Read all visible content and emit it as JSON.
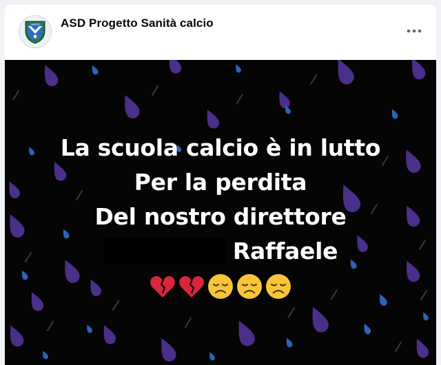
{
  "post": {
    "page_name": "ASD Progetto Sanità calcio",
    "avatar_text": "SANITÀ",
    "more_icon": "more-horizontal-icon",
    "image": {
      "lines": [
        "La scuola calcio è in lutto",
        "Per la perdita",
        "Del nostro direttore",
        "Raffaele"
      ],
      "emojis": [
        "broken-heart-icon",
        "broken-heart-icon",
        "disappointed-face-icon",
        "disappointed-face-icon",
        "disappointed-face-icon"
      ],
      "redacted": true
    }
  },
  "colors": {
    "background": "#050505",
    "raindrop_purple": "#4b2f8a",
    "raindrop_blue": "#2c64b8",
    "text": "#ffffff"
  }
}
